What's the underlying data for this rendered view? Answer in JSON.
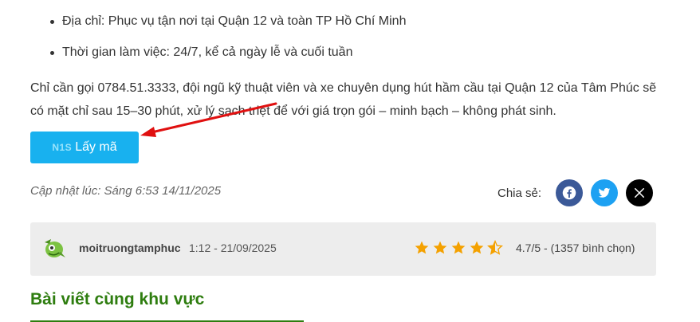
{
  "bullets": [
    "Địa chỉ: Phục vụ tận nơi tại Quận 12 và toàn TP Hồ Chí Minh",
    "Thời gian làm việc: 24/7, kể cả ngày lễ và cuối tuần"
  ],
  "paragraph": "Chỉ cần gọi 0784.51.3333, đội ngũ kỹ thuật viên và xe chuyên dụng hút hầm cầu tại Quận 12 của Tâm Phúc sẽ có mặt chỉ sau 15–30 phút, xử lý sạch triệt để với giá trọn gói – minh bạch – không phát sinh.",
  "code_button": {
    "code": "N1S",
    "label": "Lấy mã",
    "color": "#18b1ef"
  },
  "updated": "Cập nhật lúc: Sáng 6:53 14/11/2025",
  "share": {
    "label": "Chia sẻ:",
    "buttons": [
      {
        "icon": "facebook-icon",
        "color": "#3b5998"
      },
      {
        "icon": "twitter-icon",
        "color": "#1da1f2"
      },
      {
        "icon": "x-icon",
        "color": "#000000"
      }
    ]
  },
  "author": {
    "name": "moitruongtamphuc",
    "time": "1:12 - 21/09/2025",
    "avatar_icon": "mascot-avatar-icon",
    "rating": 4.7,
    "rating_max": 5,
    "rating_text": "4.7/5 - (1357 bình chọn)",
    "star_color": "#f4a100"
  },
  "section": {
    "title": "Bài viết cùng khu vực",
    "color": "#2e7d0f"
  }
}
